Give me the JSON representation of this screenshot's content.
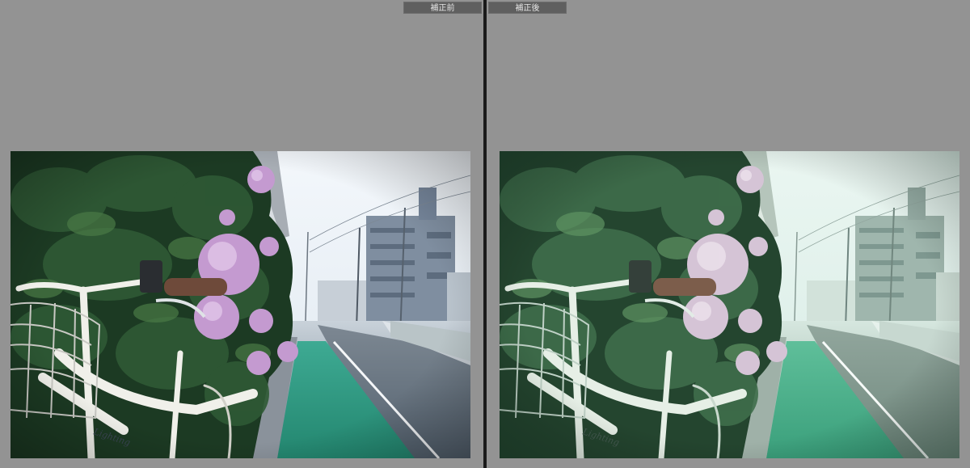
{
  "comparison": {
    "before": {
      "label": "補正前"
    },
    "after": {
      "label": "補正後"
    }
  },
  "colors": {
    "background": "#939393",
    "divider": "#1a1a1a",
    "tab": "#5f5f5f"
  }
}
